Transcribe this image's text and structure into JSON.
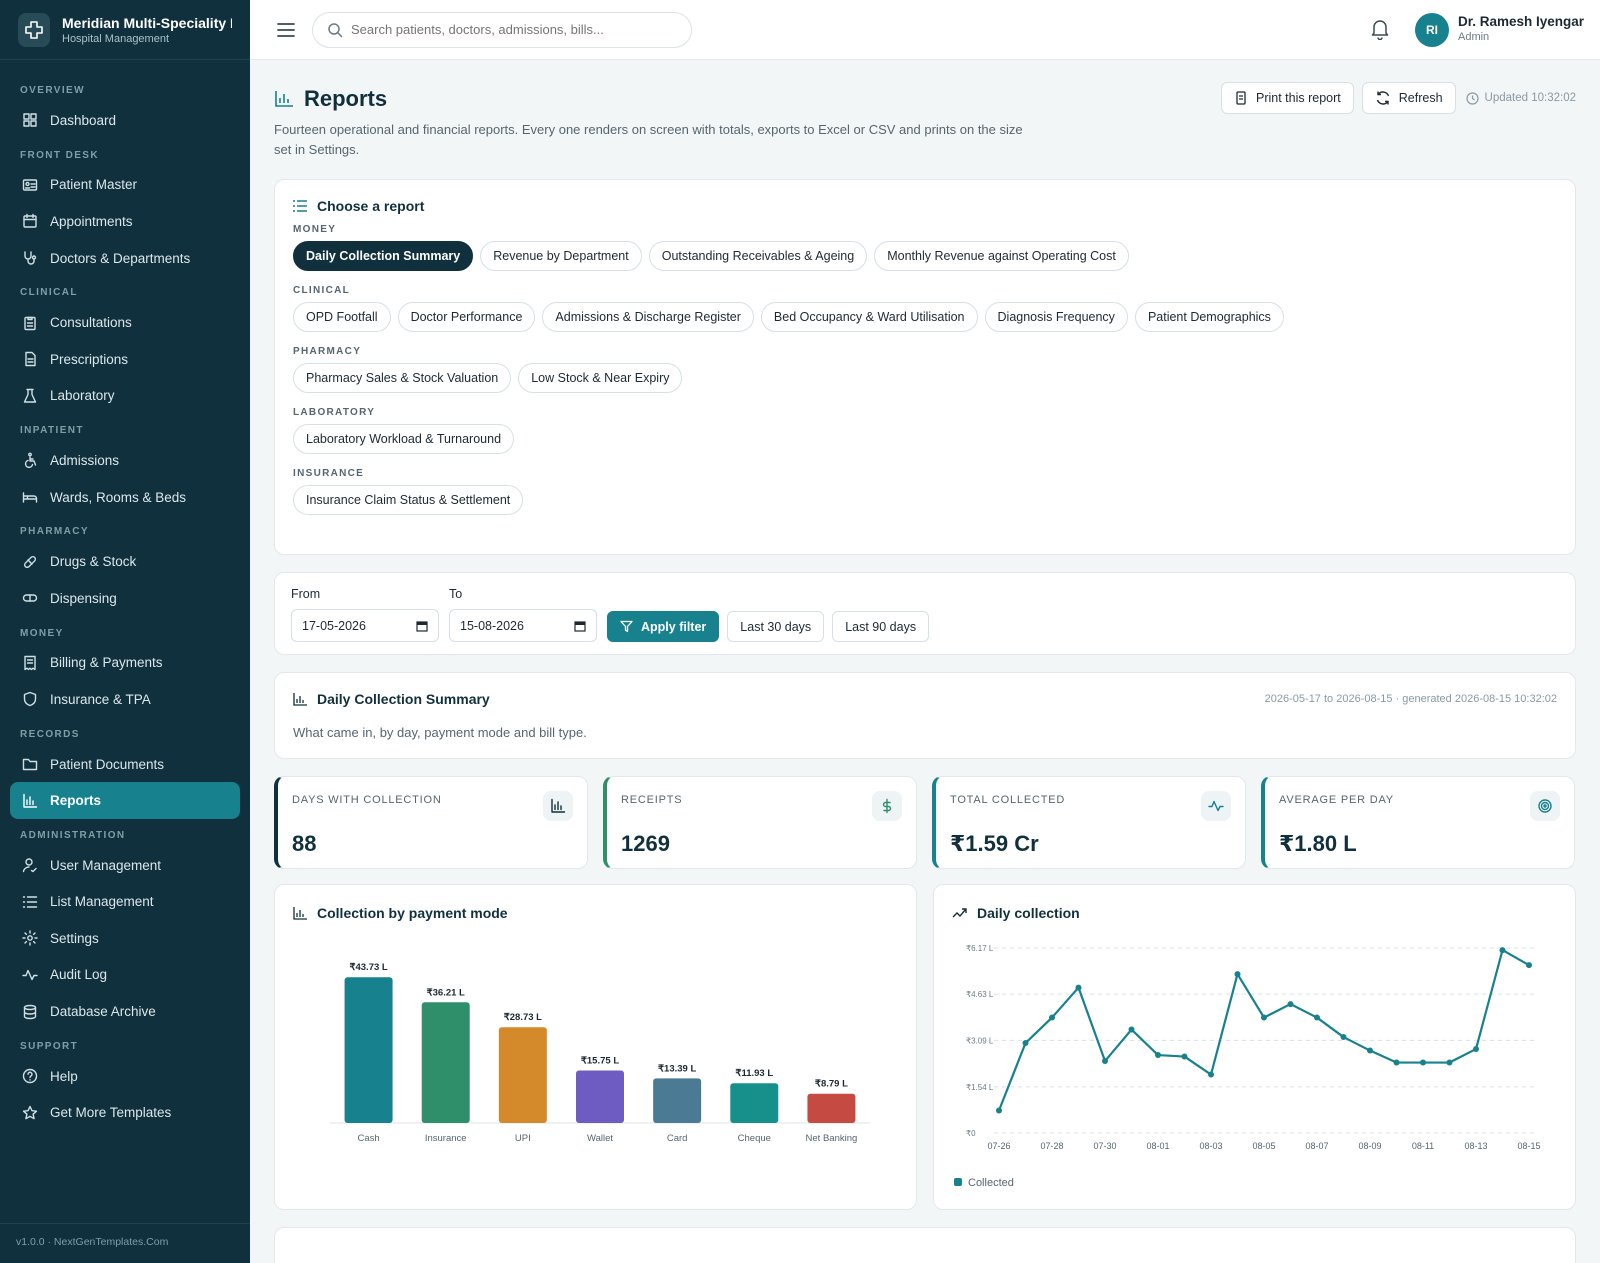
{
  "brand": {
    "name": "Meridian Multi-Speciality Hospital",
    "sub": "Hospital Management"
  },
  "sidebar": {
    "sections": [
      {
        "label": "OVERVIEW",
        "items": [
          {
            "label": "Dashboard",
            "icon": "dashboard-icon"
          }
        ]
      },
      {
        "label": "FRONT DESK",
        "items": [
          {
            "label": "Patient Master",
            "icon": "id-card-icon"
          },
          {
            "label": "Appointments",
            "icon": "calendar-icon"
          },
          {
            "label": "Doctors & Departments",
            "icon": "stethoscope-icon"
          }
        ]
      },
      {
        "label": "CLINICAL",
        "items": [
          {
            "label": "Consultations",
            "icon": "clipboard-icon"
          },
          {
            "label": "Prescriptions",
            "icon": "document-icon"
          },
          {
            "label": "Laboratory",
            "icon": "flask-icon"
          }
        ]
      },
      {
        "label": "INPATIENT",
        "items": [
          {
            "label": "Admissions",
            "icon": "wheelchair-icon"
          },
          {
            "label": "Wards, Rooms & Beds",
            "icon": "bed-icon"
          }
        ]
      },
      {
        "label": "PHARMACY",
        "items": [
          {
            "label": "Drugs & Stock",
            "icon": "pill-icon"
          },
          {
            "label": "Dispensing",
            "icon": "capsule-icon"
          }
        ]
      },
      {
        "label": "MONEY",
        "items": [
          {
            "label": "Billing & Payments",
            "icon": "receipt-icon"
          },
          {
            "label": "Insurance & TPA",
            "icon": "shield-icon"
          }
        ]
      },
      {
        "label": "RECORDS",
        "items": [
          {
            "label": "Patient Documents",
            "icon": "folder-icon"
          },
          {
            "label": "Reports",
            "icon": "bar-chart-icon",
            "active": true
          }
        ]
      },
      {
        "label": "ADMINISTRATION",
        "items": [
          {
            "label": "User Management",
            "icon": "user-icon"
          },
          {
            "label": "List Management",
            "icon": "list-icon"
          },
          {
            "label": "Settings",
            "icon": "gear-icon"
          },
          {
            "label": "Audit Log",
            "icon": "activity-icon"
          },
          {
            "label": "Database Archive",
            "icon": "database-icon"
          }
        ]
      },
      {
        "label": "SUPPORT",
        "items": [
          {
            "label": "Help",
            "icon": "help-icon"
          },
          {
            "label": "Get More Templates",
            "icon": "star-icon"
          }
        ]
      }
    ],
    "footer": "v1.0.0 · NextGenTemplates.Com"
  },
  "topbar": {
    "search_placeholder": "Search patients, doctors, admissions, bills...",
    "user_initials": "RI",
    "user_name": "Dr. Ramesh Iyengar",
    "user_role": "Admin"
  },
  "page": {
    "title": "Reports",
    "description": "Fourteen operational and financial reports. Every one renders on screen with totals, exports to Excel or CSV and prints on the size set in Settings.",
    "print_label": "Print this report",
    "refresh_label": "Refresh",
    "updated": "Updated 10:32:02"
  },
  "chooser": {
    "title": "Choose a report",
    "groups": [
      {
        "label": "MONEY",
        "reports": [
          "Daily Collection Summary",
          "Revenue by Department",
          "Outstanding Receivables & Ageing",
          "Monthly Revenue against Operating Cost"
        ]
      },
      {
        "label": "CLINICAL",
        "reports": [
          "OPD Footfall",
          "Doctor Performance",
          "Admissions & Discharge Register",
          "Bed Occupancy & Ward Utilisation",
          "Diagnosis Frequency",
          "Patient Demographics"
        ]
      },
      {
        "label": "PHARMACY",
        "reports": [
          "Pharmacy Sales & Stock Valuation",
          "Low Stock & Near Expiry"
        ]
      },
      {
        "label": "LABORATORY",
        "reports": [
          "Laboratory Workload & Turnaround"
        ]
      },
      {
        "label": "INSURANCE",
        "reports": [
          "Insurance Claim Status & Settlement"
        ]
      }
    ],
    "active": "Daily Collection Summary"
  },
  "filter": {
    "from_label": "From",
    "from_value": "17-05-2026",
    "to_label": "To",
    "to_value": "15-08-2026",
    "apply_label": "Apply filter",
    "last30_label": "Last 30 days",
    "last90_label": "Last 90 days"
  },
  "report": {
    "title": "Daily Collection Summary",
    "meta": "2026-05-17 to 2026-08-15 · generated 2026-08-15 10:32:02",
    "description": "What came in, by day, payment mode and bill type."
  },
  "kpis": [
    {
      "label": "DAYS WITH COLLECTION",
      "value": "88",
      "icon": "bar-chart-icon",
      "color": "#11303d"
    },
    {
      "label": "RECEIPTS",
      "value": "1269",
      "icon": "dollar-icon",
      "color": "#2e8f6a"
    },
    {
      "label": "TOTAL COLLECTED",
      "value": "₹1.59 Cr",
      "icon": "activity-icon",
      "color": "#17818e"
    },
    {
      "label": "AVERAGE PER DAY",
      "value": "₹1.80 L",
      "icon": "target-icon",
      "color": "#17818e"
    }
  ],
  "chart_data": [
    {
      "type": "bar",
      "title": "Collection by payment mode",
      "categories": [
        "Cash",
        "Insurance",
        "UPI",
        "Wallet",
        "Card",
        "Cheque",
        "Net Banking"
      ],
      "values": [
        43.73,
        36.21,
        28.73,
        15.75,
        13.39,
        11.93,
        8.79
      ],
      "value_labels": [
        "₹43.73 L",
        "₹36.21 L",
        "₹28.73 L",
        "₹15.75 L",
        "₹13.39 L",
        "₹11.93 L",
        "₹8.79 L"
      ],
      "colors": [
        "#17818e",
        "#2e8f6a",
        "#d4892a",
        "#6f5cc2",
        "#4a7a94",
        "#17908c",
        "#c44a42"
      ],
      "ylim": [
        0,
        45
      ]
    },
    {
      "type": "line",
      "title": "Daily collection",
      "x": [
        "07-26",
        "07-27",
        "07-28",
        "07-29",
        "07-30",
        "07-31",
        "08-01",
        "08-02",
        "08-03",
        "08-04",
        "08-05",
        "08-06",
        "08-07",
        "08-08",
        "08-09",
        "08-10",
        "08-11",
        "08-12",
        "08-13",
        "08-14",
        "08-15"
      ],
      "x_ticks": [
        "07-26",
        "07-28",
        "07-30",
        "08-01",
        "08-03",
        "08-05",
        "08-07",
        "08-09",
        "08-11",
        "08-13",
        "08-15"
      ],
      "y_ticks": [
        "₹0",
        "₹1.54 L",
        "₹3.09 L",
        "₹4.63 L",
        "₹6.17 L"
      ],
      "series": [
        {
          "name": "Collected",
          "color": "#17818e",
          "values": [
            0.75,
            3.0,
            3.85,
            4.85,
            2.4,
            3.45,
            2.6,
            2.55,
            1.95,
            5.3,
            3.85,
            4.3,
            3.85,
            3.2,
            2.75,
            2.35,
            2.35,
            2.35,
            2.8,
            6.1,
            5.6
          ]
        }
      ],
      "ylim": [
        0,
        6.17
      ]
    }
  ]
}
